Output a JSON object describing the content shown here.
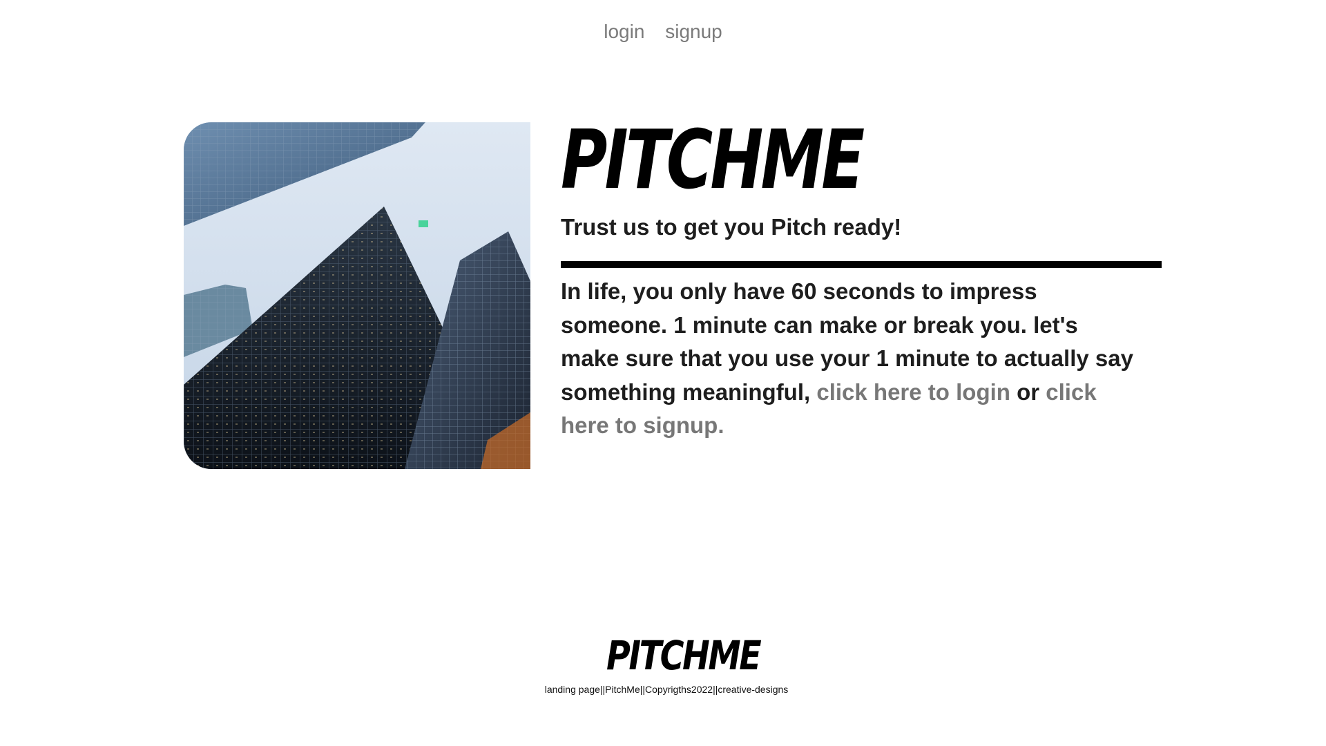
{
  "nav": {
    "login": "login",
    "signup": "signup"
  },
  "hero": {
    "image_alt": "low-angle view of glass skyscrapers",
    "brand": "PITCHME",
    "tagline": "Trust us to get you Pitch ready!",
    "body_text": "In life, you only have 60 seconds to impress someone. 1 minute can make or break you. let's make sure that you use your 1 minute to actually say something meaningful,",
    "login_link": "click here to login",
    "or_text": "or",
    "signup_link": "click here to signup."
  },
  "footer": {
    "brand": "PITCHME",
    "text": "landing page||PitchMe||Copyrigths2022||creative-designs"
  },
  "colors": {
    "text": "#1e1e1e",
    "link": "#777777",
    "nav": "#7a7a7a",
    "divider": "#000000"
  }
}
